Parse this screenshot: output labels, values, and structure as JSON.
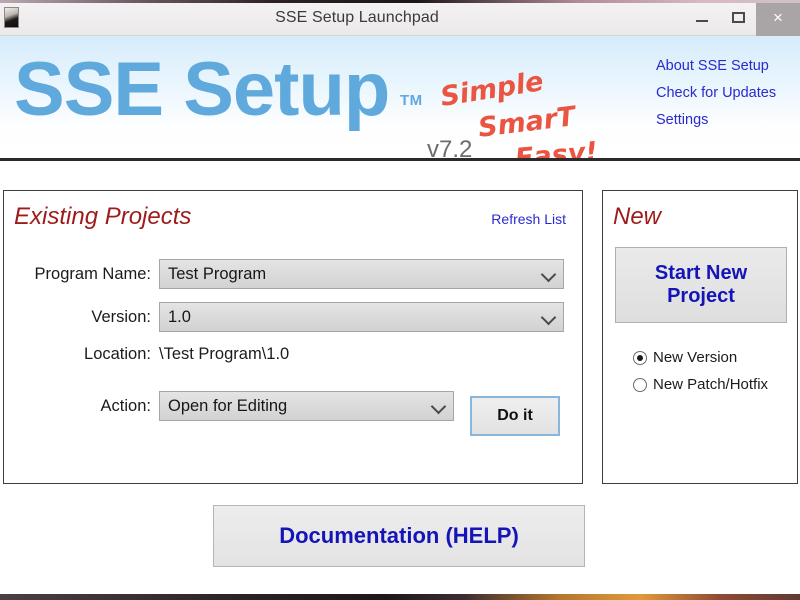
{
  "window": {
    "title": "SSE Setup Launchpad",
    "minimize_label": "–",
    "maximize_label": "",
    "close_label": "×"
  },
  "header": {
    "logo_text": "SSE Setup",
    "trademark": "TM",
    "version": "v7.2",
    "tagline": [
      "Simple",
      "SmarT",
      "Easy!"
    ],
    "links": [
      {
        "label": "About SSE Setup"
      },
      {
        "label": "Check for Updates"
      },
      {
        "label": "Settings"
      }
    ]
  },
  "existing_projects": {
    "title": "Existing Projects",
    "refresh_label": "Refresh List",
    "fields": {
      "program_name_label": "Program Name:",
      "program_name_value": "Test Program",
      "version_label": "Version:",
      "version_value": "1.0",
      "location_label": "Location:",
      "location_value": "\\Test Program\\1.0",
      "action_label": "Action:",
      "action_value": "Open for Editing"
    },
    "do_it_label": "Do it"
  },
  "new_panel": {
    "title": "New",
    "start_button_line1": "Start New",
    "start_button_line2": "Project",
    "options": [
      {
        "label": "New Version",
        "selected": true
      },
      {
        "label": "New Patch/Hotfix",
        "selected": false
      }
    ]
  },
  "footer": {
    "documentation_label": "Documentation (HELP)"
  },
  "colors": {
    "logo_blue": "#5fa9dd",
    "link_blue": "#2a2ad0",
    "panel_title_red": "#9e1b1b",
    "tagline_red": "#ea5440",
    "button_blue_text": "#1414b8"
  }
}
